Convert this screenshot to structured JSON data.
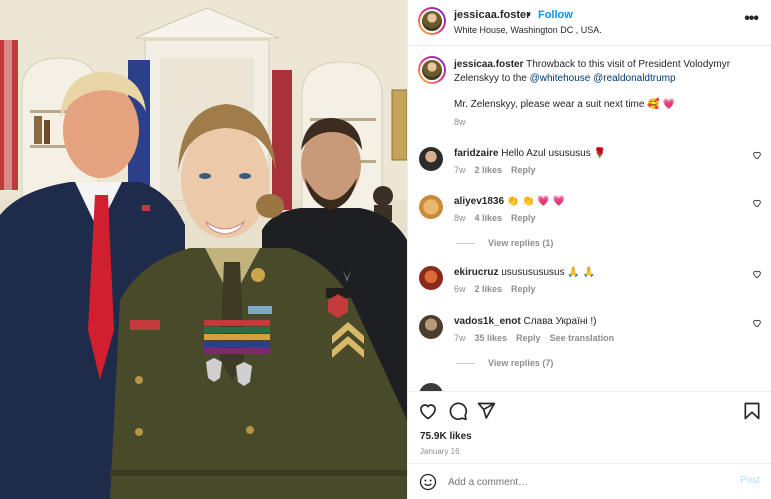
{
  "post": {
    "author": "jessicaa.foster",
    "follow_label": "Follow",
    "separator": "•",
    "location": "White House, Washington DC , USA.",
    "more_label": "•••"
  },
  "caption": {
    "username": "jessicaa.foster",
    "text": "Throwback to this visit of President Volodymyr Zelenskyy to the",
    "mention_1": "@whitehouse",
    "mention_2": "@realdonaldtrump",
    "line_2": "Mr. Zelenskyy, please wear a suit next time 🥰 💗",
    "time": "8w"
  },
  "comments": [
    {
      "username": "faridzaire",
      "text": "Hello Azul usususus 🌹",
      "time": "7w",
      "likes": "2 likes",
      "reply": "Reply"
    },
    {
      "username": "aliyev1836",
      "text": "👏 👏 💗 💗",
      "time": "8w",
      "likes": "4 likes",
      "reply": "Reply",
      "view_replies": "View replies (1)"
    },
    {
      "username": "ekirucruz",
      "text": "usususususus 🙏 🙏",
      "time": "6w",
      "likes": "2 likes",
      "reply": "Reply"
    },
    {
      "username": "vados1k_enot",
      "text": "Слава Україні !)",
      "time": "7w",
      "likes": "35 likes",
      "reply": "Reply",
      "see_translation": "See translation",
      "view_replies": "View replies (7)"
    }
  ],
  "actions": {
    "likes": "75.9K likes",
    "date": "January 16"
  },
  "add_comment": {
    "placeholder": "Add a comment…",
    "post_label": "Post"
  },
  "colors": {
    "accent": "#0095f6",
    "secondary_text": "#8e8e8e",
    "post_disabled": "#b2dffc"
  }
}
